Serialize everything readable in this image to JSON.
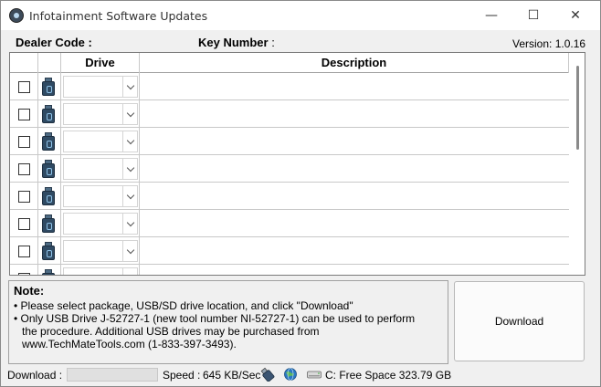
{
  "window": {
    "title": "Infotainment Software Updates",
    "controls": {
      "minimize": "—",
      "maximize": "☐",
      "close": "✕"
    }
  },
  "header": {
    "dealer_code_label": "Dealer Code :",
    "key_number_label": "Key Number",
    "key_number_colon": ":",
    "version": "Version: 1.0.16"
  },
  "grid": {
    "columns": [
      "",
      "",
      "Drive",
      "Description"
    ],
    "rows": [
      {
        "checked": false,
        "drive": "",
        "description": ""
      },
      {
        "checked": false,
        "drive": "",
        "description": ""
      },
      {
        "checked": false,
        "drive": "",
        "description": ""
      },
      {
        "checked": false,
        "drive": "",
        "description": ""
      },
      {
        "checked": false,
        "drive": "",
        "description": ""
      },
      {
        "checked": false,
        "drive": "",
        "description": ""
      },
      {
        "checked": false,
        "drive": "",
        "description": ""
      },
      {
        "checked": false,
        "drive": "",
        "description": ""
      }
    ]
  },
  "note": {
    "title": "Note:",
    "line1": "• Please select package, USB/SD drive location, and click \"Download\"",
    "line2": "• Only USB Drive J-52727-1 (new tool number NI-52727-1) can be used to perform",
    "line3": "the procedure. Additional USB drives may be purchased from",
    "line4": "www.TechMateTools.com (1-833-397-3493)."
  },
  "download_button": "Download",
  "status": {
    "download_label": "Download :",
    "progress": 0,
    "speed_label": "Speed :",
    "speed_value": "645 KB/Sec",
    "free_space": "C: Free Space 323.79 GB",
    "icons": [
      "usb-drive-icon",
      "globe-icon",
      "hard-drive-icon"
    ]
  }
}
